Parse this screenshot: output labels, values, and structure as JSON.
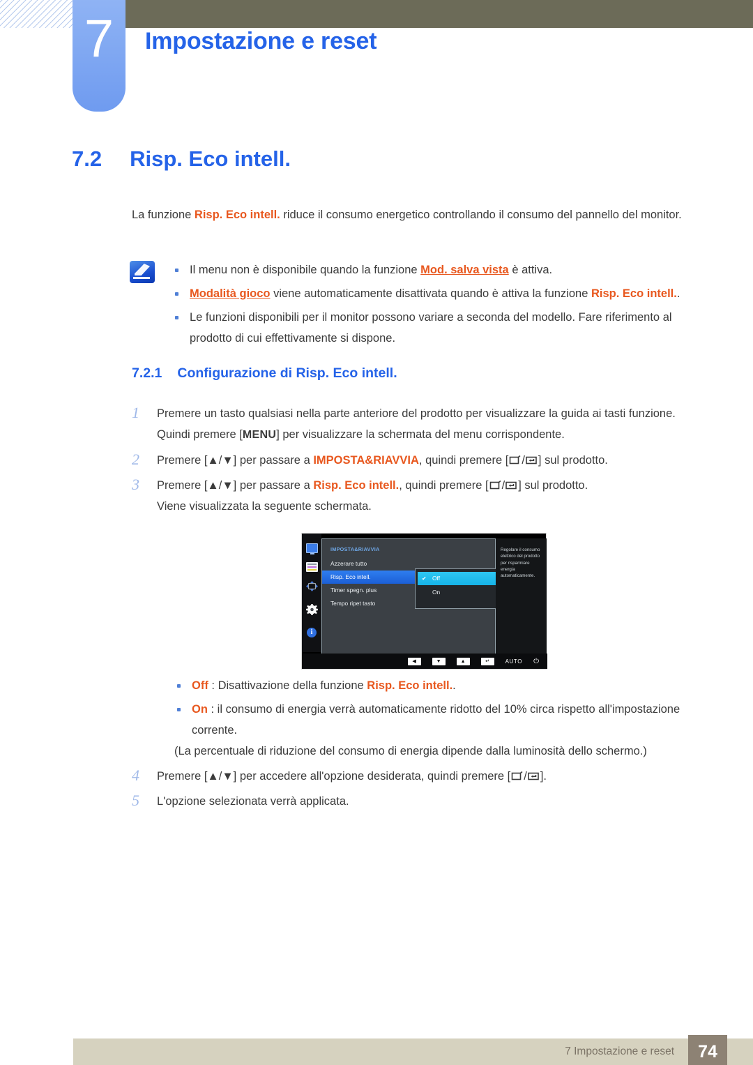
{
  "header": {
    "chapter_number": "7",
    "chapter_title": "Impostazione e reset"
  },
  "section": {
    "number": "7.2",
    "title": "Risp. Eco intell."
  },
  "intro": {
    "before": "La funzione ",
    "keyword": "Risp. Eco intell.",
    "after": " riduce il consumo energetico controllando il consumo del pannello del monitor."
  },
  "note": {
    "icon": "note-pencil-icon",
    "items": [
      {
        "b1": "Il menu non è disponibile quando la funzione ",
        "link": "Mod. salva vista",
        "b2": " è attiva."
      },
      {
        "b1": "",
        "link": "Modalità gioco",
        "b2": " viene automaticamente disattivata quando è attiva la funzione ",
        "kw": "Risp. Eco intell.",
        "b3": "."
      },
      {
        "b1": "Le funzioni disponibili per il monitor possono variare a seconda del modello. Fare riferimento al prodotto di cui effettivamente si dispone."
      }
    ]
  },
  "subsection": {
    "number": "7.2.1",
    "title": "Configurazione di Risp. Eco intell."
  },
  "steps": [
    {
      "num": "1",
      "t1": "Premere un tasto qualsiasi nella parte anteriore del prodotto per visualizzare la guida ai tasti funzione. Quindi premere [",
      "kbd": "MENU",
      "t2": "] per visualizzare la schermata del menu corrispondente."
    },
    {
      "num": "2",
      "t1": "Premere [▲/▼] per passare a ",
      "kw": "IMPOSTA&RIAVVIA",
      "t2": ", quindi premere [",
      "t3": "] sul prodotto."
    },
    {
      "num": "3",
      "t1": "Premere [▲/▼] per passare a ",
      "kw": "Risp. Eco intell.",
      "t2": ", quindi premere [",
      "t3": "] sul prodotto.",
      "extra": "Viene visualizzata la seguente schermata."
    },
    {
      "num": "4",
      "t1": "Premere [▲/▼] per accedere all'opzione desiderata, quindi premere [",
      "t3": "]."
    },
    {
      "num": "5",
      "t1": "L'opzione selezionata verrà applicata."
    }
  ],
  "osd": {
    "menu_title": "IMPOSTA&RIAVVIA",
    "menu_items": [
      "Azzerare tutto",
      "Risp. Eco intell.",
      "Timer spegn. plus",
      "Tempo ripet tasto"
    ],
    "selected_item": "Risp. Eco intell.",
    "dropdown_options": [
      "Off",
      "On"
    ],
    "dropdown_selected": "Off",
    "help_text": "Regolare il consumo elettrico del prodotto per risparmiare energia automaticamente.",
    "sidebar_icons": [
      "monitor-icon",
      "list-icon",
      "move-arrows-icon",
      "gear-icon",
      "info-icon"
    ],
    "bottom_buttons": [
      "◀",
      "▼",
      "▲",
      "↵"
    ],
    "auto_label": "AUTO",
    "power_icon": "power-icon"
  },
  "options": [
    {
      "name": "Off",
      "desc_before": " : Disattivazione della funzione ",
      "kw": "Risp. Eco intell.",
      "desc_after": "."
    },
    {
      "name": "On",
      "desc_before": " : il consumo di energia verrà automaticamente ridotto del 10% circa rispetto all'impostazione corrente."
    }
  ],
  "parenthetical": "(La percentuale di riduzione del consumo di energia dipende dalla luminosità dello schermo.)",
  "footer": {
    "label": "7 Impostazione e reset",
    "page": "74"
  },
  "colors": {
    "accent_blue": "#2563e8",
    "keyword_orange": "#e8581f",
    "topbar_olive": "#6c6b58",
    "footer_tan": "#d6d2bf",
    "page_badge": "#8d8274"
  }
}
